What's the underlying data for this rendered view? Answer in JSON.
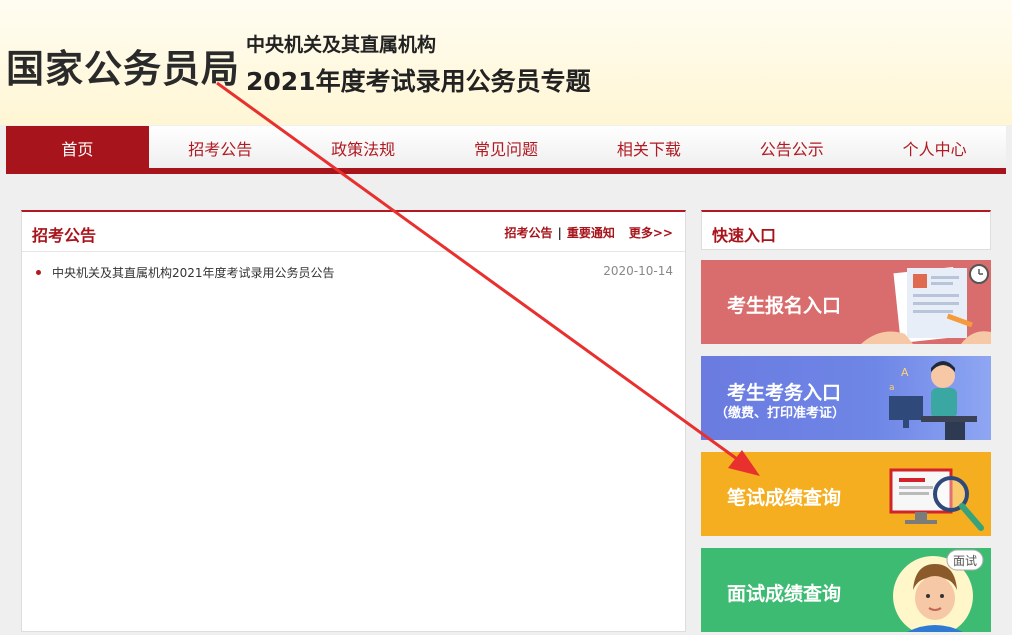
{
  "header": {
    "logo": "国家公务员局",
    "subtitle_line1": "中央机关及其直属机构",
    "subtitle_line2": "2021年度考试录用公务员专题"
  },
  "nav": {
    "items": [
      {
        "label": "首页",
        "active": true
      },
      {
        "label": "招考公告"
      },
      {
        "label": "政策法规"
      },
      {
        "label": "常见问题"
      },
      {
        "label": "相关下载"
      },
      {
        "label": "公告公示"
      },
      {
        "label": "个人中心"
      }
    ]
  },
  "announcements": {
    "title": "招考公告",
    "link1": "招考公告",
    "separator": "|",
    "link2": "重要通知",
    "more": "更多>>",
    "items": [
      {
        "title": "中央机关及其直属机构2021年度考试录用公务员公告",
        "date": "2020-10-14"
      }
    ]
  },
  "quick_entry": {
    "title": "快速入口",
    "entries": [
      {
        "label": "考生报名入口",
        "color": "#d96d6d"
      },
      {
        "label": "考生考务入口",
        "sub": "（缴费、打印准考证）",
        "color": "#6b7be0"
      },
      {
        "label": "笔试成绩查询",
        "color": "#f5ae1f"
      },
      {
        "label": "面试成绩查询",
        "badge": "面试",
        "color": "#3dbb72"
      }
    ]
  },
  "colors": {
    "brand_red": "#a8141b",
    "arrow_red": "#e8302f"
  }
}
